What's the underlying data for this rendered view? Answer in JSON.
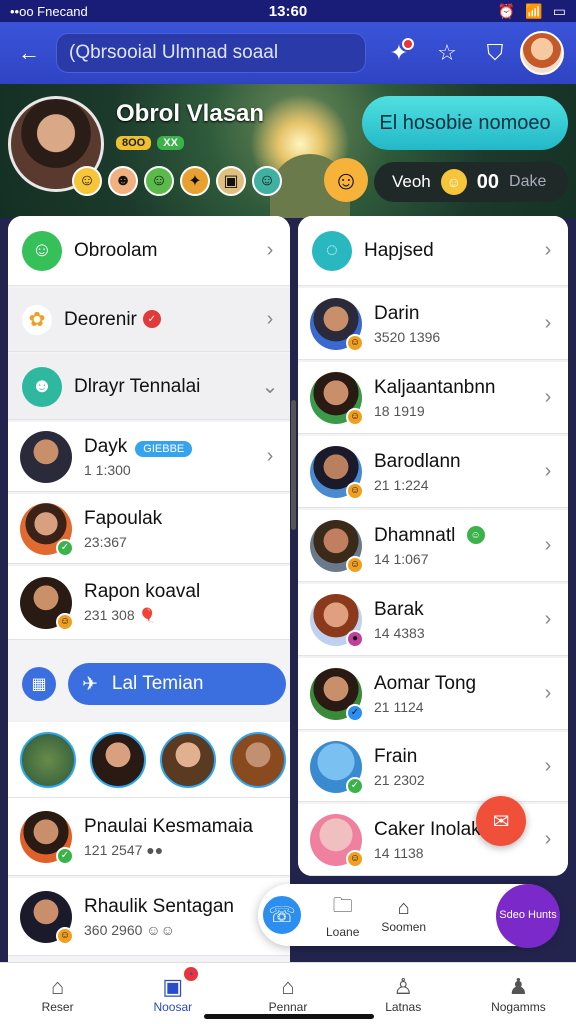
{
  "status_bar": {
    "left": "••oo Fnecand",
    "time": "13:60"
  },
  "header": {
    "search_placeholder": "(Qbrsooial Ulmnad soaal"
  },
  "banner": {
    "name": "Obrol Vlasan",
    "stat1": "8OO",
    "stat2": "XX",
    "cta": "El hosobie nomoeo",
    "view_label": "Veoh",
    "view_count": "00",
    "view_extra": "Dake"
  },
  "left_list": {
    "group1": "Obroolam",
    "group2": "Deorenir",
    "group3": "Dlrayr Tennalai",
    "contacts": [
      {
        "name": "Dayk",
        "tag": "GIEBBE",
        "sub": "1 1:300"
      },
      {
        "name": "Fapoulak",
        "sub": "23:367"
      },
      {
        "name": "Rapon koaval",
        "sub": "231 308"
      }
    ],
    "action_label": "Lal Temian",
    "contacts2": [
      {
        "name": "Pnaulai Kesmamaia",
        "sub": "121 2547"
      },
      {
        "name": "Rhaulik Sentagan",
        "sub": "360 2960"
      }
    ]
  },
  "right_list": {
    "header": "Hapjsed",
    "contacts": [
      {
        "name": "Darin",
        "sub": "3520 1396"
      },
      {
        "name": "Kaljaantanbnn",
        "sub": "18 1919"
      },
      {
        "name": "Barodlann",
        "sub": "21 1:224"
      },
      {
        "name": "Dhamnatl",
        "sub": "14 1:067"
      },
      {
        "name": "Barak",
        "sub": "14 4383"
      },
      {
        "name": "Aomar Tong",
        "sub": "21 1124"
      },
      {
        "name": "Frain",
        "sub": "21 2302"
      },
      {
        "name": "Caker Inolak",
        "sub": "14 1138"
      }
    ]
  },
  "floatbar": {
    "item1": "Loane",
    "item2": "Soomen"
  },
  "fab_purple": "Sdeo Hunts",
  "bottom_nav": [
    {
      "label": "Reser"
    },
    {
      "label": "Noosar"
    },
    {
      "label": "Pennar"
    },
    {
      "label": "Latnas"
    },
    {
      "label": "Nogamms"
    }
  ],
  "colors": {
    "primary": "#3a54d9",
    "accent_cyan": "#23b8c8",
    "fab_red": "#f0503a",
    "purple": "#7b29c9"
  }
}
